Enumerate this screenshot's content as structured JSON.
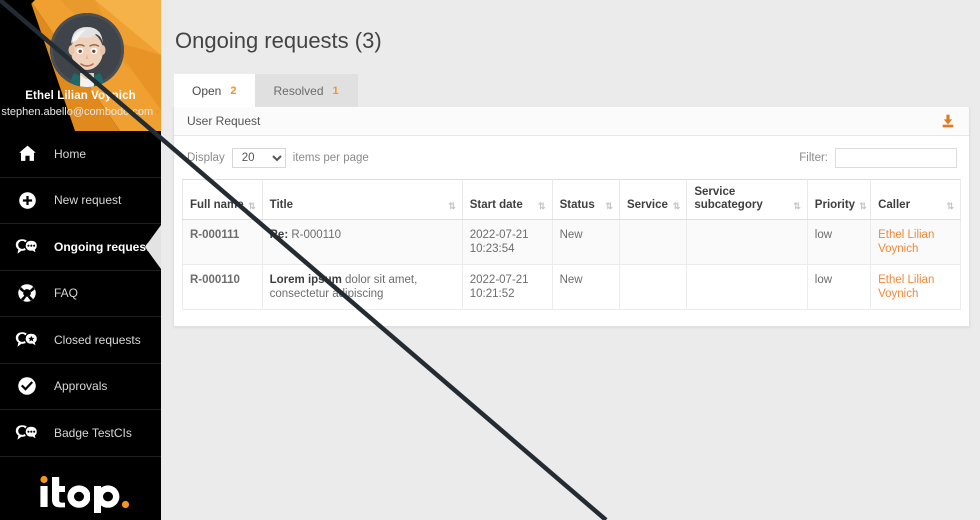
{
  "colors": {
    "accent_orange": "#f7941e",
    "link_orange": "#f0883a",
    "sidebar_black": "#000000",
    "page_bg": "#ebebeb",
    "panel_white": "#ffffff",
    "diagonal_line": "#232b33"
  },
  "sidebar": {
    "profile": {
      "name": "Ethel Lilian Voynich",
      "email": "stephen.abello@combodo.com",
      "caret": "▾",
      "avatar_icon": "user-avatar"
    },
    "items": [
      {
        "label": "Home",
        "icon": "home-icon",
        "active": false
      },
      {
        "label": "New request",
        "icon": "plus-circle-icon",
        "active": false
      },
      {
        "label": "Ongoing requests",
        "icon": "ongoing-requests-icon",
        "active": true
      },
      {
        "label": "FAQ",
        "icon": "lifebuoy-icon",
        "active": false
      },
      {
        "label": "Closed requests",
        "icon": "closed-requests-icon",
        "active": false
      },
      {
        "label": "Approvals",
        "icon": "check-circle-icon",
        "active": false
      },
      {
        "label": "Badge TestCIs",
        "icon": "badge-icon",
        "active": false
      }
    ],
    "brand": {
      "text": "itop",
      "dot": "."
    }
  },
  "main": {
    "page_title": "Ongoing requests (3)",
    "tabs": [
      {
        "label": "Open",
        "count": "2",
        "active": true
      },
      {
        "label": "Resolved",
        "count": "1",
        "active": false
      }
    ],
    "panel": {
      "title": "User Request",
      "export_icon": "download-icon"
    },
    "toolbar": {
      "display_label": "Display",
      "display_value": "20",
      "display_options": [
        "20"
      ],
      "items_per_page_label": "items per page",
      "filter_label": "Filter:",
      "filter_value": "",
      "filter_placeholder": ""
    },
    "table": {
      "columns": [
        {
          "label": "Full name",
          "sortable": true
        },
        {
          "label": "Title",
          "sortable": true
        },
        {
          "label": "Start date",
          "sortable": true
        },
        {
          "label": "Status",
          "sortable": true
        },
        {
          "label": "Service",
          "sortable": true
        },
        {
          "label": "Service subcategory",
          "sortable": true
        },
        {
          "label": "Priority",
          "sortable": true
        },
        {
          "label": "Caller",
          "sortable": true
        }
      ],
      "sort_glyph": "⇅",
      "rows": [
        {
          "full_name": "R-000111",
          "title_lead": "Re:",
          "title_rest": " R-000110",
          "start_date_line1": "2022-07-21",
          "start_date_line2": "10:23:54",
          "status": "New",
          "service": "",
          "service_subcategory": "",
          "priority": "low",
          "caller": "Ethel Lilian Voynich"
        },
        {
          "full_name": "R-000110",
          "title_lead": "Lorem ipsum",
          "title_rest": " dolor sit amet, consectetur adipiscing",
          "start_date_line1": "2022-07-21",
          "start_date_line2": "10:21:52",
          "status": "New",
          "service": "",
          "service_subcategory": "",
          "priority": "low",
          "caller": "Ethel Lilian Voynich"
        }
      ]
    }
  },
  "overlay": {
    "diagonal_line_label": "annotation-diagonal-line"
  }
}
